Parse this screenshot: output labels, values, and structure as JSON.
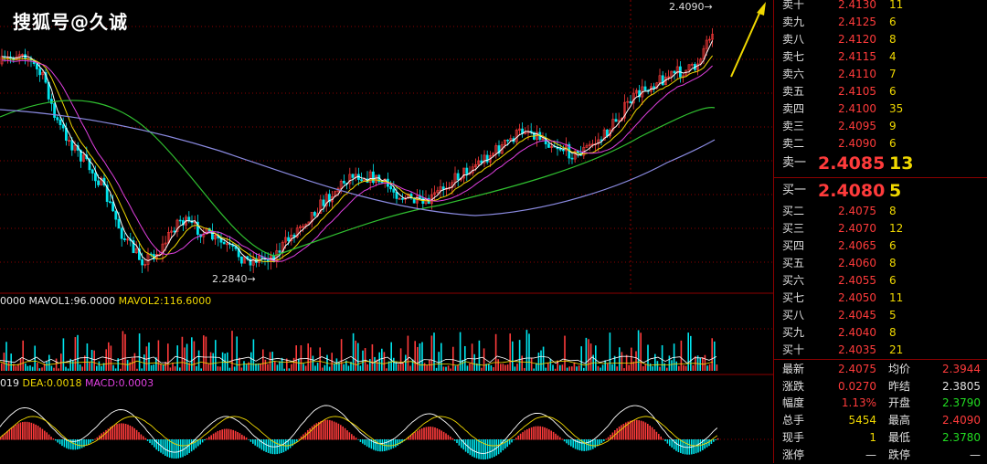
{
  "watermark": "搜狐号@久诚",
  "main_chart": {
    "high_label": "2.4090",
    "low_label": "2.2840"
  },
  "volume_panel": {
    "vol_label": "0000",
    "mavol1_label": "MAVOL1:96.0000",
    "mavol2_label": "MAVOL2:116.6000"
  },
  "macd_panel": {
    "diff_label": "019",
    "dea_label": "DEA:0.0018",
    "macd_label": "MACD:0.0003"
  },
  "colors": {
    "up": "#ff3b3b",
    "down": "#00e5ee",
    "ma_white": "#ffffff",
    "ma_yellow": "#f0d800",
    "ma_magenta": "#e040e0",
    "ma_green": "#30c030",
    "ma_slate": "#8a8ae0",
    "grid": "#8b0000"
  },
  "orderbook": {
    "asks": [
      {
        "label": "卖十",
        "price": "2.4130",
        "qty": "11"
      },
      {
        "label": "卖九",
        "price": "2.4125",
        "qty": "6"
      },
      {
        "label": "卖八",
        "price": "2.4120",
        "qty": "8"
      },
      {
        "label": "卖七",
        "price": "2.4115",
        "qty": "4"
      },
      {
        "label": "卖六",
        "price": "2.4110",
        "qty": "7"
      },
      {
        "label": "卖五",
        "price": "2.4105",
        "qty": "6"
      },
      {
        "label": "卖四",
        "price": "2.4100",
        "qty": "35"
      },
      {
        "label": "卖三",
        "price": "2.4095",
        "qty": "9"
      },
      {
        "label": "卖二",
        "price": "2.4090",
        "qty": "6"
      },
      {
        "label": "卖一",
        "price": "2.4085",
        "qty": "13"
      }
    ],
    "bids": [
      {
        "label": "买一",
        "price": "2.4080",
        "qty": "5"
      },
      {
        "label": "买二",
        "price": "2.4075",
        "qty": "8"
      },
      {
        "label": "买三",
        "price": "2.4070",
        "qty": "12"
      },
      {
        "label": "买四",
        "price": "2.4065",
        "qty": "6"
      },
      {
        "label": "买五",
        "price": "2.4060",
        "qty": "8"
      },
      {
        "label": "买六",
        "price": "2.4055",
        "qty": "6"
      },
      {
        "label": "买七",
        "price": "2.4050",
        "qty": "11"
      },
      {
        "label": "买八",
        "price": "2.4045",
        "qty": "5"
      },
      {
        "label": "买九",
        "price": "2.4040",
        "qty": "8"
      },
      {
        "label": "买十",
        "price": "2.4035",
        "qty": "21"
      }
    ]
  },
  "stats": [
    {
      "l1": "最新",
      "v1": "2.4075",
      "c1": "red",
      "l2": "均价",
      "v2": "2.3944",
      "c2": "red"
    },
    {
      "l1": "涨跌",
      "v1": "0.0270",
      "c1": "red",
      "l2": "昨结",
      "v2": "2.3805",
      "c2": "white"
    },
    {
      "l1": "幅度",
      "v1": "1.13%",
      "c1": "red",
      "l2": "开盘",
      "v2": "2.3790",
      "c2": "green"
    },
    {
      "l1": "总手",
      "v1": "5454",
      "c1": "yellow",
      "l2": "最高",
      "v2": "2.4090",
      "c2": "red"
    },
    {
      "l1": "现手",
      "v1": "1",
      "c1": "yellow",
      "l2": "最低",
      "v2": "2.3780",
      "c2": "green"
    },
    {
      "l1": "涨停",
      "v1": "—",
      "c1": "white",
      "l2": "跌停",
      "v2": "—",
      "c2": "white"
    }
  ]
}
